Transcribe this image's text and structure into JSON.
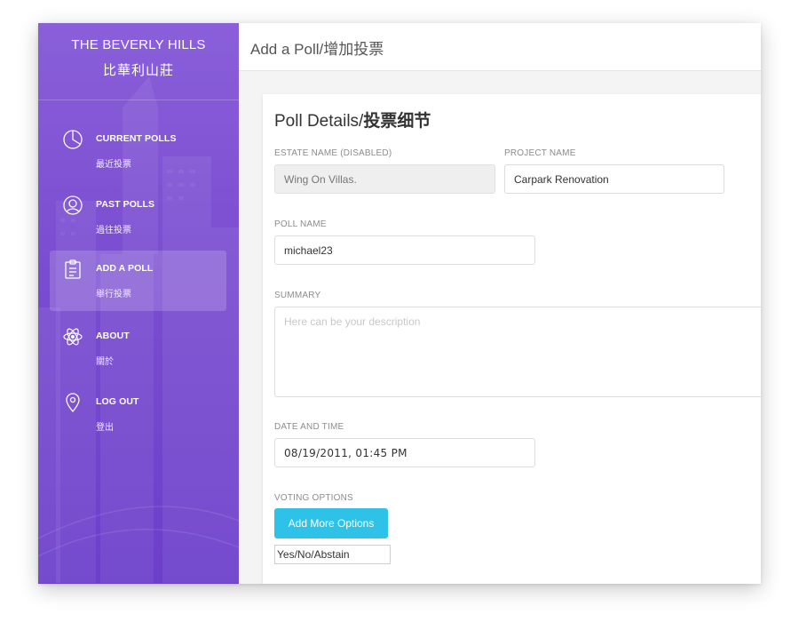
{
  "sidebar": {
    "brand_en": "THE BEVERLY HILLS",
    "brand_zh": "比華利山莊",
    "items": [
      {
        "label": "CURRENT POLLS",
        "sub": "最近投票",
        "icon": "pie-chart-icon"
      },
      {
        "label": "PAST POLLS",
        "sub": "過往投票",
        "icon": "user-icon"
      },
      {
        "label": "ADD A POLL",
        "sub": "舉行投票",
        "icon": "clipboard-icon",
        "active": true
      },
      {
        "label": "ABOUT",
        "sub": "關於",
        "icon": "atom-icon"
      },
      {
        "label": "LOG OUT",
        "sub": "登出",
        "icon": "location-pin-icon"
      }
    ]
  },
  "header": {
    "title": "Add a Poll/增加投票"
  },
  "form": {
    "title_en": "Poll Details/",
    "title_zh": "投票细节",
    "estate_label": "ESTATE NAME (DISABLED)",
    "estate_value": "Wing On Villas.",
    "project_label": "PROJECT NAME",
    "project_value": "Carpark Renovation",
    "poll_name_label": "POLL NAME",
    "poll_name_value": "michael23",
    "summary_label": "SUMMARY",
    "summary_placeholder": "Here can be your description",
    "datetime_label": "DATE AND TIME",
    "datetime_value": "08/19/2011, 01:45 PM",
    "voting_label": "VOTING OPTIONS",
    "add_options_button": "Add More Options",
    "option_value": "Yes/No/Abstain"
  },
  "colors": {
    "sidebar_top": "#8a5fd9",
    "sidebar_bottom": "#6c3fcb",
    "button": "#2fc2e8"
  }
}
